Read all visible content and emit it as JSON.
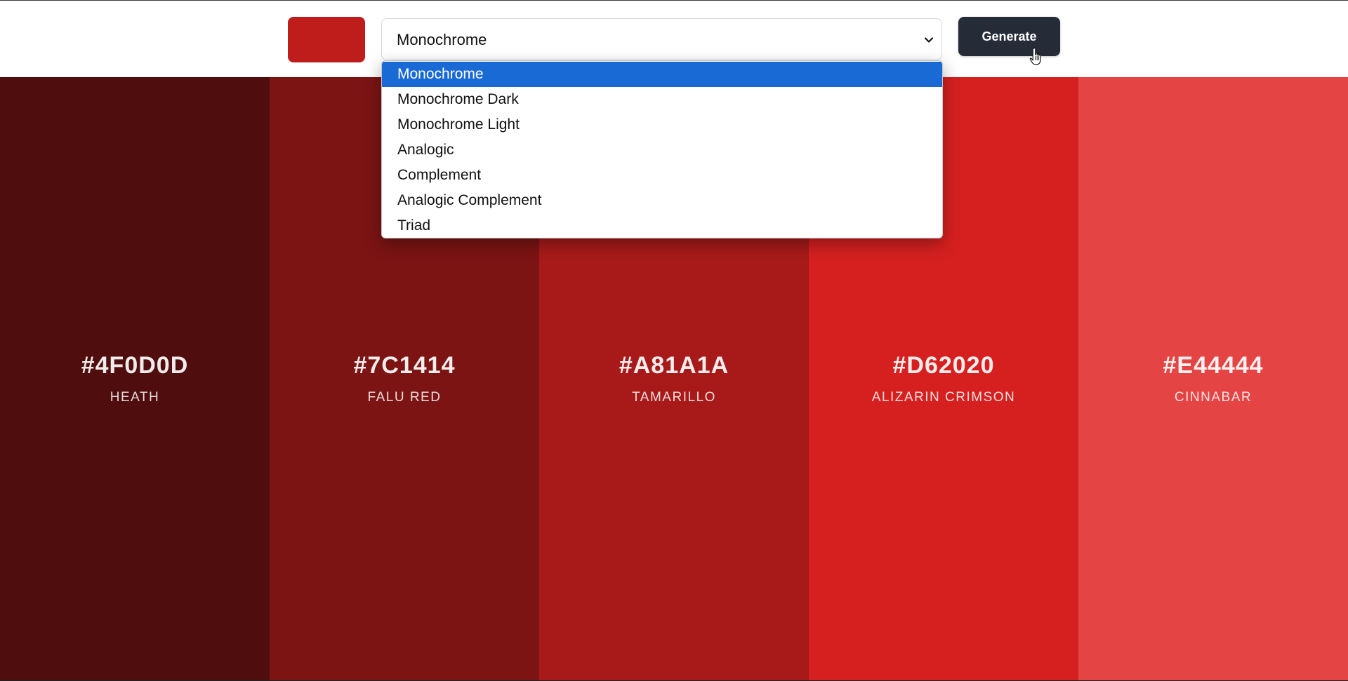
{
  "header": {
    "picked_color": "#bf1c1c",
    "scheme_select": {
      "value": "Monochrome",
      "options": [
        "Monochrome",
        "Monochrome Dark",
        "Monochrome Light",
        "Analogic",
        "Complement",
        "Analogic Complement",
        "Triad"
      ],
      "highlighted_index": 0
    },
    "generate_label": "Generate"
  },
  "palette": [
    {
      "hex": "#4F0D0D",
      "name": "HEATH",
      "color": "#4F0D0D"
    },
    {
      "hex": "#7C1414",
      "name": "FALU RED",
      "color": "#7C1414"
    },
    {
      "hex": "#A81A1A",
      "name": "TAMARILLO",
      "color": "#A81A1A"
    },
    {
      "hex": "#D62020",
      "name": "ALIZARIN CRIMSON",
      "color": "#D62020"
    },
    {
      "hex": "#E44444",
      "name": "CINNABAR",
      "color": "#E44444"
    }
  ],
  "icons": {
    "chevron": "chevron-down-icon",
    "cursor": "hand-pointer-cursor-icon"
  }
}
